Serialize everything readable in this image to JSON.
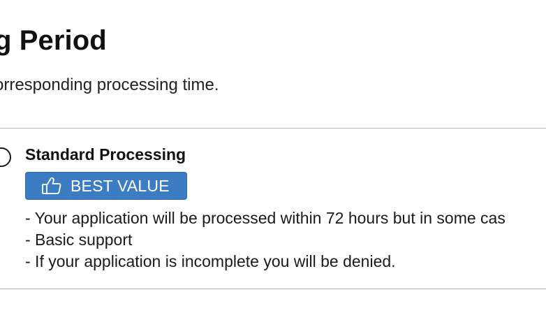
{
  "header": {
    "title": "g Period",
    "subtitle": "orresponding processing time."
  },
  "option": {
    "title": "Standard Processing",
    "selected": false,
    "badge": {
      "icon": "thumbs-up-icon",
      "label": "BEST VALUE",
      "color": "#3c7cc2"
    },
    "features": [
      "- Your application will be processed within 72 hours but in some cas",
      "- Basic support",
      "- If your application is incomplete you will be denied."
    ]
  }
}
